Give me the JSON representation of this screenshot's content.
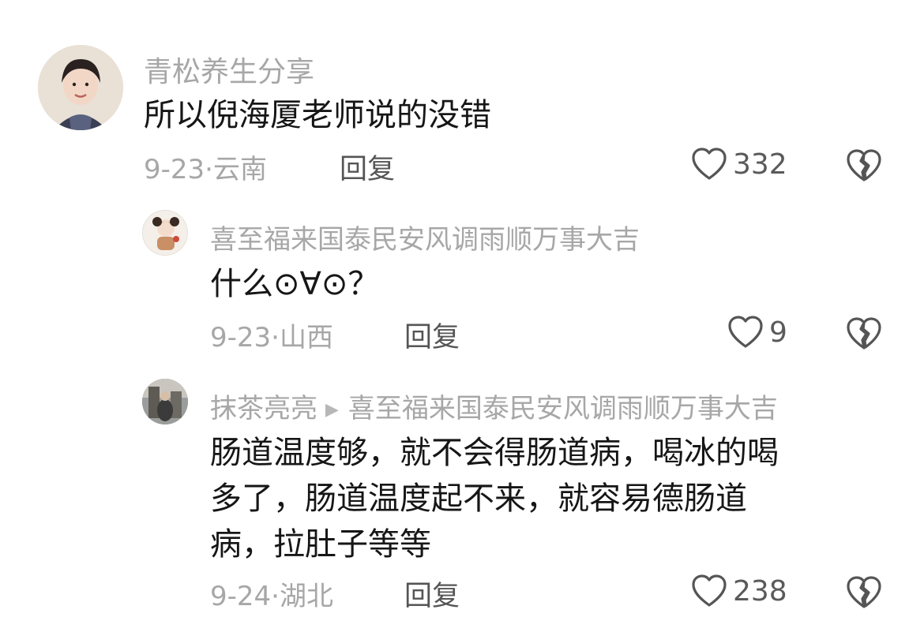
{
  "comments": [
    {
      "username": "青松养生分享",
      "text": "所以倪海厦老师说的没错",
      "date": "9-23",
      "location": "云南",
      "reply_label": "回复",
      "likes": "332"
    },
    {
      "username": "喜至福来国泰民安风调雨顺万事大吉",
      "text": "什么⊙∀⊙？",
      "date": "9-23",
      "location": "山西",
      "reply_label": "回复",
      "likes": "9"
    },
    {
      "username": "抹茶亮亮",
      "reply_to": "喜至福来国泰民安风调雨顺万事大吉",
      "text_lines": [
        "肠道温度够，就不会得肠道病，喝冰的喝",
        "多了，肠道温度起不来，就容易德肠道",
        "病，拉肚子等等"
      ],
      "date": "9-24",
      "location": "湖北",
      "reply_label": "回复",
      "likes": "238"
    }
  ],
  "separator": "·",
  "icons": {
    "like": "heart-outline-icon",
    "dislike": "broken-heart-icon",
    "reply_arrow": "triangle-right-icon"
  },
  "colors": {
    "username": "#a7a7a7",
    "text": "#161616",
    "meta": "#a7a7a7",
    "icon": "#555555"
  }
}
